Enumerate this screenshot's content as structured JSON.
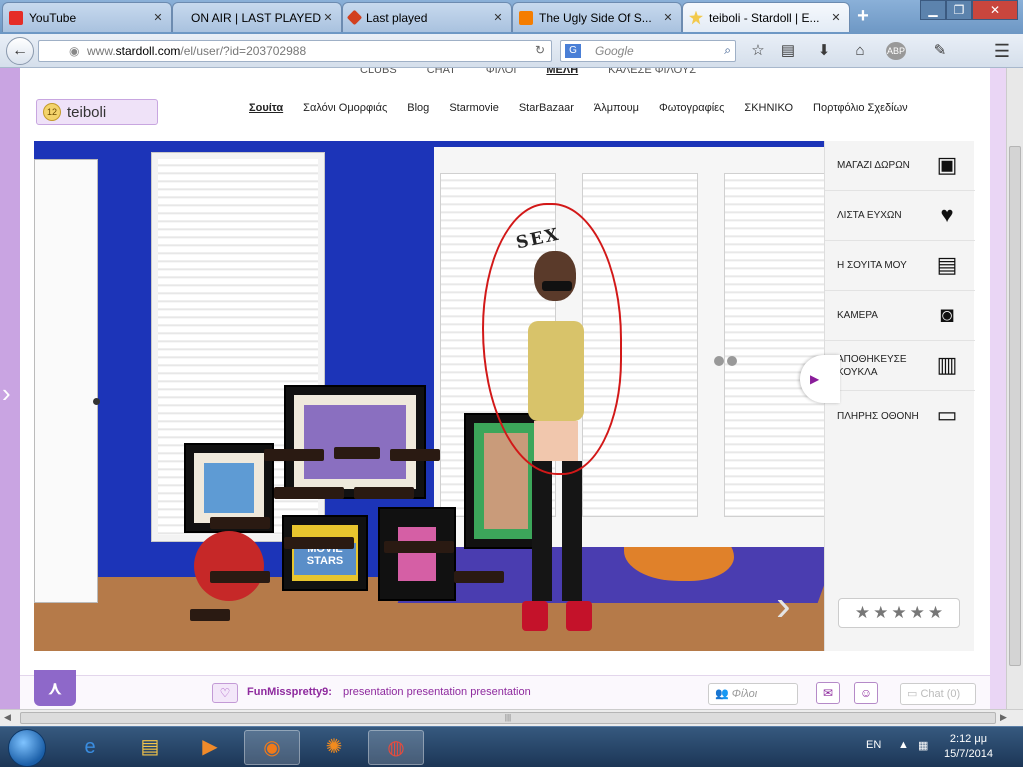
{
  "browser": {
    "tabs": [
      {
        "title": "YouTube",
        "favicon_color": "#e52d27",
        "active": false
      },
      {
        "title": "ON AIR | LAST PLAYED...",
        "favicon_color": "#ffffff",
        "active": false
      },
      {
        "title": "Last played",
        "favicon_color": "#d2401f",
        "active": false
      },
      {
        "title": "The Ugly Side Of S...",
        "favicon_color": "#f57d00",
        "active": false
      },
      {
        "title": "teiboli - Stardoll | E...",
        "favicon_color": "#f2c94c",
        "active": true
      }
    ],
    "url_prefix": "www.",
    "url_host": "stardoll.com",
    "url_path": "/el/user/?id=203702988",
    "search_placeholder": "Google"
  },
  "page": {
    "top_links": [
      "CLUBS",
      "CHAT",
      "ΦΙΛΟΙ",
      "ΜΕΛΗ",
      "ΚΑΛΕΣΕ ΦΙΛΟΥΣ"
    ],
    "user": {
      "name": "teiboli",
      "level": "12"
    },
    "subnav": [
      "Σουίτα",
      "Σαλόνι Ομορφιάς",
      "Blog",
      "Starmovie",
      "StarBazaar",
      "Άλμπουμ",
      "Φωτογραφίες",
      "ΣΚΗΝΙΚΟ",
      "Πορτφόλιο Σχεδίων"
    ],
    "suite": {
      "avatar_sign": "SEX",
      "poster_text": "MOVIE STARS"
    },
    "side_menu": [
      {
        "label": "ΜΑΓΑΖΙ ΔΩΡΩΝ",
        "icon": "gift-box-icon",
        "glyph": "▣"
      },
      {
        "label": "ΛΙΣΤΑ ΕΥΧΩΝ",
        "icon": "heart-icon",
        "glyph": "♥"
      },
      {
        "label": "Η ΣΟΥΙΤΑ ΜΟΥ",
        "icon": "suite-icon",
        "glyph": "▤"
      },
      {
        "label": "ΚΑΜΕΡΑ",
        "icon": "camera-icon",
        "glyph": "◙"
      },
      {
        "label": "ΑΠΟΘΗΚΕΥΣΕ ΚΟΥΚΛΑ",
        "icon": "save-doll-icon",
        "glyph": "▥"
      },
      {
        "label": "ΠΛΗΡΗΣ ΟΘΟΝΗ",
        "icon": "fullscreen-icon",
        "glyph": "▭"
      }
    ],
    "rating_stars": 5,
    "bottom_bar": {
      "message_user": "FunMisspretty9",
      "message_text": "presentation presentation presentation",
      "friends_placeholder": "Φίλοι",
      "chat_label": "Chat (0)"
    }
  },
  "taskbar": {
    "language": "EN",
    "time": "2:12 μμ",
    "date": "15/7/2014"
  }
}
